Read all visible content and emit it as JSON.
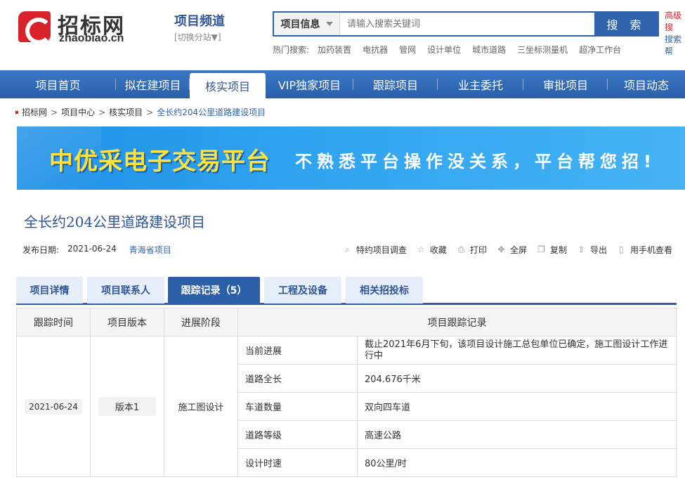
{
  "header": {
    "logo_cn": "招标网",
    "logo_en": "zhaobiao.cn",
    "channel_title": "项目频道",
    "channel_switch": "[切换分站▼]",
    "search_type": "项目信息",
    "search_placeholder": "请输入搜索关键词",
    "search_button": "搜 索",
    "adv_line1": "高级搜",
    "adv_line2": "搜索帮",
    "hot_label": "热门搜索:",
    "hot_items": [
      "加药装置",
      "电抗器",
      "管网",
      "设计单位",
      "城市道路",
      "三坐标测量机",
      "超净工作台"
    ]
  },
  "nav": {
    "items": [
      "项目首页",
      "拟在建项目",
      "核实项目",
      "VIP独家项目",
      "跟踪项目",
      "业主委托",
      "审批项目",
      "项目动态"
    ],
    "active_index": 2
  },
  "breadcrumb": [
    "招标网",
    "项目中心",
    "核实项目",
    "全长约204公里道路建设项目"
  ],
  "banner": {
    "title": "中优采电子交易平台",
    "subtitle": "不熟悉平台操作没关系，平台帮您招!"
  },
  "project": {
    "title": "全长约204公里道路建设项目",
    "date_label": "发布日期:",
    "date": "2021-06-24",
    "province": "青海省项目"
  },
  "tools": [
    {
      "label": "特约项目调查",
      "icon": "search-icon"
    },
    {
      "label": "收藏",
      "icon": "star-icon"
    },
    {
      "label": "打印",
      "icon": "printer-icon"
    },
    {
      "label": "全屏",
      "icon": "fullscreen-icon"
    },
    {
      "label": "复制",
      "icon": "copy-icon"
    },
    {
      "label": "导出",
      "icon": "export-icon"
    },
    {
      "label": "用手机查看",
      "icon": "mobile-icon"
    }
  ],
  "tabs": [
    "项目详情",
    "项目联系人",
    "跟踪记录（5）",
    "工程及设备",
    "相关招投标"
  ],
  "table": {
    "headers": [
      "跟踪时间",
      "项目版本",
      "进展阶段",
      "项目跟踪记录"
    ],
    "track_time": "2021-06-24",
    "version": "版本1",
    "stage": "施工图设计",
    "records": [
      {
        "key": "当前进展",
        "value": "截止2021年6月下旬，该项目设计施工总包单位已确定，施工图设计工作进行中"
      },
      {
        "key": "道路全长",
        "value": "204.676千米"
      },
      {
        "key": "车道数量",
        "value": "双向四车道"
      },
      {
        "key": "道路等级",
        "value": "高速公路"
      },
      {
        "key": "设计时速",
        "value": "80公里/时"
      }
    ]
  }
}
